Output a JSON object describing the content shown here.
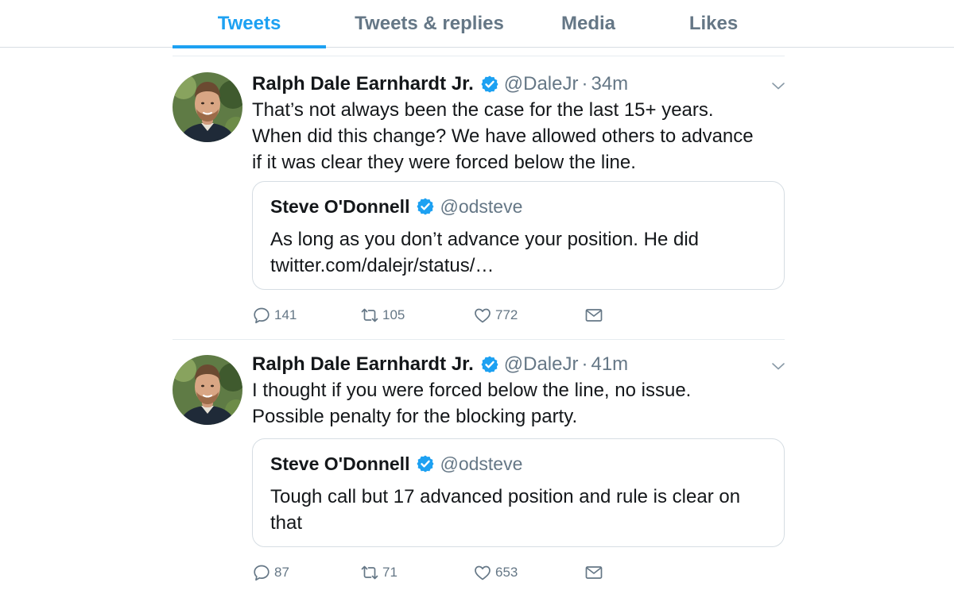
{
  "tabs": [
    {
      "label": "Tweets",
      "active": true
    },
    {
      "label": "Tweets & replies",
      "active": false
    },
    {
      "label": "Media",
      "active": false
    },
    {
      "label": "Likes",
      "active": false
    }
  ],
  "colors": {
    "accent": "#1da1f2",
    "secondary_text": "#657786",
    "primary_text": "#14171a"
  },
  "tweets": [
    {
      "name": "Ralph Dale Earnhardt Jr.",
      "verified": true,
      "handle": "@DaleJr",
      "separator": "·",
      "time": "34m",
      "text_lines": [
        "That’s not always been the case for the last 15+ years.",
        "When did this change? We have allowed others to advance",
        "if it was clear they were forced below the line."
      ],
      "quote": {
        "name": "Steve O'Donnell",
        "verified": true,
        "handle": "@odsteve",
        "text_lines": [
          "As long as you don’t advance your position.   He did",
          "twitter.com/dalejr/status/…"
        ]
      },
      "replies": "141",
      "retweets": "105",
      "likes": "772",
      "icons": [
        "reply-icon",
        "retweet-icon",
        "heart-icon",
        "envelope-icon"
      ]
    },
    {
      "name": "Ralph Dale Earnhardt Jr.",
      "verified": true,
      "handle": "@DaleJr",
      "separator": "·",
      "time": "41m",
      "text_lines": [
        "I thought if you were forced below the line, no issue.",
        "Possible penalty for the blocking party."
      ],
      "quote": {
        "name": "Steve O'Donnell",
        "verified": true,
        "handle": "@odsteve",
        "text_lines": [
          "Tough call but 17 advanced position and rule is clear on",
          "that"
        ]
      },
      "replies": "87",
      "retweets": "71",
      "likes": "653",
      "icons": [
        "reply-icon",
        "retweet-icon",
        "heart-icon",
        "envelope-icon"
      ]
    }
  ]
}
